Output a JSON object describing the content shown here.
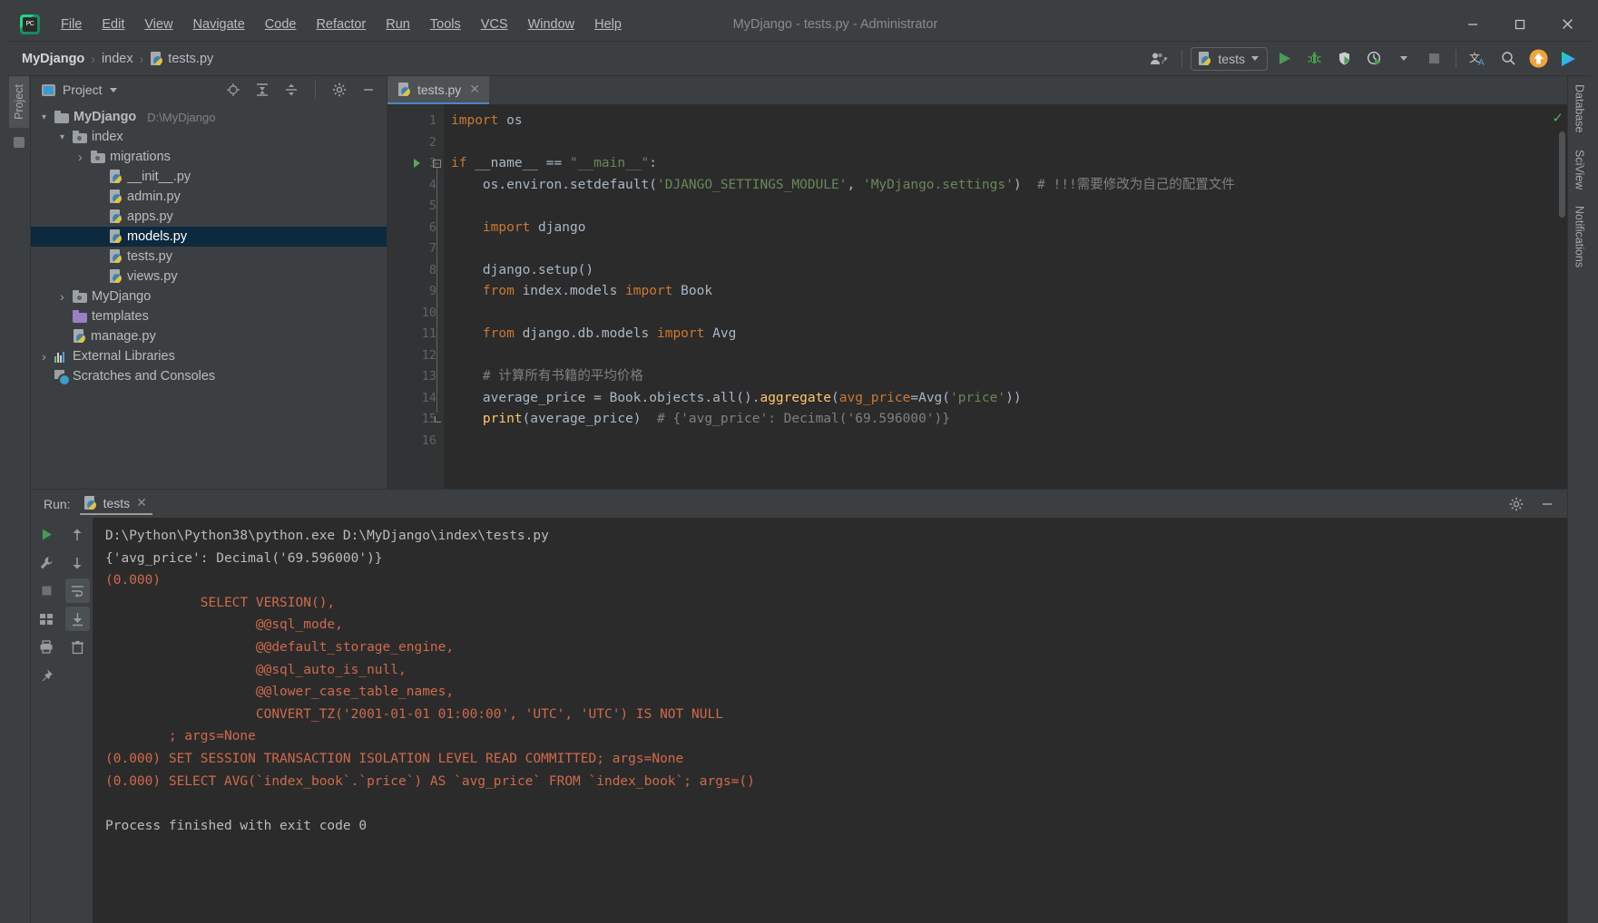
{
  "window": {
    "title": "MyDjango - tests.py - Administrator",
    "logo_label": "PC",
    "minimize": "—",
    "maximize": "□",
    "close": "✕"
  },
  "menubar": {
    "items": [
      {
        "label": "File"
      },
      {
        "label": "Edit"
      },
      {
        "label": "View"
      },
      {
        "label": "Navigate"
      },
      {
        "label": "Code"
      },
      {
        "label": "Refactor"
      },
      {
        "label": "Run"
      },
      {
        "label": "Tools"
      },
      {
        "label": "VCS"
      },
      {
        "label": "Window"
      },
      {
        "label": "Help"
      }
    ]
  },
  "navbar": {
    "breadcrumbs": [
      {
        "label": "MyDjango",
        "bold": true
      },
      {
        "label": "index",
        "bold": false
      },
      {
        "label": "tests.py",
        "bold": false,
        "icon": "python-file-icon"
      }
    ],
    "separator": "›",
    "run_config": {
      "label": "tests",
      "icon": "python-file-icon"
    },
    "buttons": [
      {
        "name": "user-switch-icon",
        "glyph": "👤"
      },
      {
        "name": "run-button",
        "glyph": "▶"
      },
      {
        "name": "debug-button",
        "glyph": "🐞"
      },
      {
        "name": "run-coverage-button",
        "glyph": "◑"
      },
      {
        "name": "profile-button",
        "glyph": "⏱"
      },
      {
        "name": "stop-button",
        "glyph": "■"
      },
      {
        "name": "translate-icon",
        "glyph": "文A"
      },
      {
        "name": "search-everywhere-icon",
        "glyph": "🔍"
      },
      {
        "name": "update-project-icon",
        "glyph": "↑"
      },
      {
        "name": "ide-plugin-icon",
        "glyph": "▶"
      }
    ]
  },
  "left_strip": {
    "tabs": [
      {
        "label": "Project",
        "active": true
      }
    ]
  },
  "right_strip": {
    "tabs": [
      {
        "label": "Database",
        "icon": "database-icon"
      },
      {
        "label": "SciView",
        "icon": "sciview-icon"
      },
      {
        "label": "Notifications",
        "icon": "bell-icon"
      }
    ]
  },
  "project_panel": {
    "title": "Project",
    "toolbar": [
      {
        "name": "select-opened-file-icon",
        "glyph": "⊕"
      },
      {
        "name": "expand-all-icon",
        "glyph": "⤓"
      },
      {
        "name": "collapse-all-icon",
        "glyph": "⤒"
      },
      {
        "name": "settings-gear-icon",
        "glyph": "⚙"
      },
      {
        "name": "hide-panel-icon",
        "glyph": "—"
      }
    ],
    "tree": [
      {
        "label": "MyDjango",
        "path": "D:\\MyDjango",
        "indent": 0,
        "arrow": "down",
        "icon": "folder-icon",
        "bold": true,
        "selected": false
      },
      {
        "label": "index",
        "path": "",
        "indent": 1,
        "arrow": "down",
        "icon": "module-folder-icon",
        "bold": false,
        "selected": false
      },
      {
        "label": "migrations",
        "path": "",
        "indent": 2,
        "arrow": "right",
        "icon": "module-folder-icon",
        "bold": false,
        "selected": false
      },
      {
        "label": "__init__.py",
        "path": "",
        "indent": 3,
        "arrow": "none",
        "icon": "python-file-icon",
        "bold": false,
        "selected": false
      },
      {
        "label": "admin.py",
        "path": "",
        "indent": 3,
        "arrow": "none",
        "icon": "python-file-icon",
        "bold": false,
        "selected": false
      },
      {
        "label": "apps.py",
        "path": "",
        "indent": 3,
        "arrow": "none",
        "icon": "python-file-icon",
        "bold": false,
        "selected": false
      },
      {
        "label": "models.py",
        "path": "",
        "indent": 3,
        "arrow": "none",
        "icon": "python-file-icon",
        "bold": false,
        "selected": true
      },
      {
        "label": "tests.py",
        "path": "",
        "indent": 3,
        "arrow": "none",
        "icon": "python-file-icon",
        "bold": false,
        "selected": false
      },
      {
        "label": "views.py",
        "path": "",
        "indent": 3,
        "arrow": "none",
        "icon": "python-file-icon",
        "bold": false,
        "selected": false
      },
      {
        "label": "MyDjango",
        "path": "",
        "indent": 1,
        "arrow": "right",
        "icon": "module-folder-icon",
        "bold": false,
        "selected": false
      },
      {
        "label": "templates",
        "path": "",
        "indent": 1,
        "arrow": "none",
        "icon": "templates-folder-icon",
        "bold": false,
        "selected": false
      },
      {
        "label": "manage.py",
        "path": "",
        "indent": 1,
        "arrow": "none",
        "icon": "python-file-icon",
        "bold": false,
        "selected": false
      },
      {
        "label": "External Libraries",
        "path": "",
        "indent": 0,
        "arrow": "right",
        "icon": "external-libraries-icon",
        "bold": false,
        "selected": false
      },
      {
        "label": "Scratches and Consoles",
        "path": "",
        "indent": 0,
        "arrow": "none",
        "icon": "scratches-icon",
        "bold": false,
        "selected": false
      }
    ]
  },
  "editor": {
    "tabs": [
      {
        "label": "tests.py",
        "icon": "python-file-icon",
        "close": "✕",
        "active": true
      }
    ],
    "inspection_status": "✓",
    "lines": [
      {
        "n": "1",
        "tokens": [
          {
            "t": "import",
            "c": "kw"
          },
          {
            "t": " os",
            "c": "id"
          }
        ]
      },
      {
        "n": "2",
        "tokens": []
      },
      {
        "n": "3",
        "tokens": [
          {
            "t": "if",
            "c": "kw"
          },
          {
            "t": " __name__ == ",
            "c": "id"
          },
          {
            "t": "\"__main__\"",
            "c": "str"
          },
          {
            "t": ":",
            "c": "id"
          }
        ],
        "runmark": true,
        "fold": true
      },
      {
        "n": "4",
        "tokens": [
          {
            "t": "    os.environ.setdefault(",
            "c": "id"
          },
          {
            "t": "'DJANGO_SETTINGS_MODULE'",
            "c": "str"
          },
          {
            "t": ", ",
            "c": "id"
          },
          {
            "t": "'MyDjango.settings'",
            "c": "str"
          },
          {
            "t": ")  ",
            "c": "id"
          },
          {
            "t": "# !!!需要修改为自己的配置文件",
            "c": "cmt"
          }
        ]
      },
      {
        "n": "5",
        "tokens": []
      },
      {
        "n": "6",
        "tokens": [
          {
            "t": "    ",
            "c": "id"
          },
          {
            "t": "import",
            "c": "kw"
          },
          {
            "t": " django",
            "c": "id"
          }
        ]
      },
      {
        "n": "7",
        "tokens": []
      },
      {
        "n": "8",
        "tokens": [
          {
            "t": "    django.setup()",
            "c": "id"
          }
        ]
      },
      {
        "n": "9",
        "tokens": [
          {
            "t": "    ",
            "c": "id"
          },
          {
            "t": "from",
            "c": "kw"
          },
          {
            "t": " index.models ",
            "c": "id"
          },
          {
            "t": "import",
            "c": "kw"
          },
          {
            "t": " Book",
            "c": "id"
          }
        ]
      },
      {
        "n": "10",
        "tokens": []
      },
      {
        "n": "11",
        "tokens": [
          {
            "t": "    ",
            "c": "id"
          },
          {
            "t": "from",
            "c": "kw"
          },
          {
            "t": " django.db.models ",
            "c": "id"
          },
          {
            "t": "import",
            "c": "kw"
          },
          {
            "t": " Avg",
            "c": "id"
          }
        ]
      },
      {
        "n": "12",
        "tokens": []
      },
      {
        "n": "13",
        "tokens": [
          {
            "t": "    # 计算所有书籍的平均价格",
            "c": "cmt"
          }
        ]
      },
      {
        "n": "14",
        "tokens": [
          {
            "t": "    average_price = Book.objects.all().",
            "c": "id"
          },
          {
            "t": "aggregate",
            "c": "fn"
          },
          {
            "t": "(",
            "c": "id"
          },
          {
            "t": "avg_price",
            "c": "kw"
          },
          {
            "t": "=Avg(",
            "c": "id"
          },
          {
            "t": "'price'",
            "c": "str"
          },
          {
            "t": "))",
            "c": "id"
          }
        ]
      },
      {
        "n": "15",
        "tokens": [
          {
            "t": "    ",
            "c": "id"
          },
          {
            "t": "print",
            "c": "fn"
          },
          {
            "t": "(average_price)  ",
            "c": "id"
          },
          {
            "t": "# {'avg_price': Decimal('69.596000')}",
            "c": "cmt"
          }
        ],
        "foldend": true
      },
      {
        "n": "16",
        "tokens": []
      }
    ]
  },
  "run_panel": {
    "label": "Run:",
    "tab": {
      "label": "tests",
      "icon": "python-file-icon",
      "close": "✕"
    },
    "header_buttons": [
      {
        "name": "settings-gear-icon",
        "glyph": "⚙"
      },
      {
        "name": "hide-panel-icon",
        "glyph": "—"
      }
    ],
    "tools_left": [
      {
        "name": "rerun-button",
        "glyph": "▶"
      },
      {
        "name": "wrench-button",
        "glyph": "🔧"
      },
      {
        "name": "stop-button",
        "glyph": "■"
      },
      {
        "name": "layout-button",
        "glyph": "▤"
      },
      {
        "name": "print-button",
        "glyph": "⎙"
      },
      {
        "name": "pin-button",
        "glyph": "📌"
      }
    ],
    "tools_right": [
      {
        "name": "scroll-up-button",
        "glyph": "↑"
      },
      {
        "name": "scroll-down-button",
        "glyph": "↓"
      },
      {
        "name": "soft-wrap-button",
        "glyph": "↵"
      },
      {
        "name": "scroll-to-end-button",
        "glyph": "↧"
      },
      {
        "name": "clear-all-button",
        "glyph": "🗑"
      }
    ],
    "output": [
      {
        "text": "D:\\Python\\Python38\\python.exe D:\\MyDjango\\index\\tests.py",
        "color": "out"
      },
      {
        "text": "{'avg_price': Decimal('69.596000')}",
        "color": "out"
      },
      {
        "text": "(0.000)",
        "color": "red"
      },
      {
        "text": "            SELECT VERSION(),",
        "color": "red"
      },
      {
        "text": "                   @@sql_mode,",
        "color": "red"
      },
      {
        "text": "                   @@default_storage_engine,",
        "color": "red"
      },
      {
        "text": "                   @@sql_auto_is_null,",
        "color": "red"
      },
      {
        "text": "                   @@lower_case_table_names,",
        "color": "red"
      },
      {
        "text": "                   CONVERT_TZ('2001-01-01 01:00:00', 'UTC', 'UTC') IS NOT NULL",
        "color": "red"
      },
      {
        "text": "        ; args=None",
        "color": "red"
      },
      {
        "text": "(0.000) SET SESSION TRANSACTION ISOLATION LEVEL READ COMMITTED; args=None",
        "color": "red"
      },
      {
        "text": "(0.000) SELECT AVG(`index_book`.`price`) AS `avg_price` FROM `index_book`; args=()",
        "color": "red"
      },
      {
        "text": "",
        "color": "out"
      },
      {
        "text": "Process finished with exit code 0",
        "color": "out"
      }
    ]
  },
  "colors": {
    "accent_blue": "#4a88c7",
    "selection": "#0d293e",
    "editor_bg": "#2b2b2b",
    "panel_bg": "#3c3f41",
    "keyword": "#cc7832",
    "string": "#6a8759",
    "comment": "#808080",
    "error_red": "#cf6a4c",
    "run_green": "#5ba85b"
  }
}
